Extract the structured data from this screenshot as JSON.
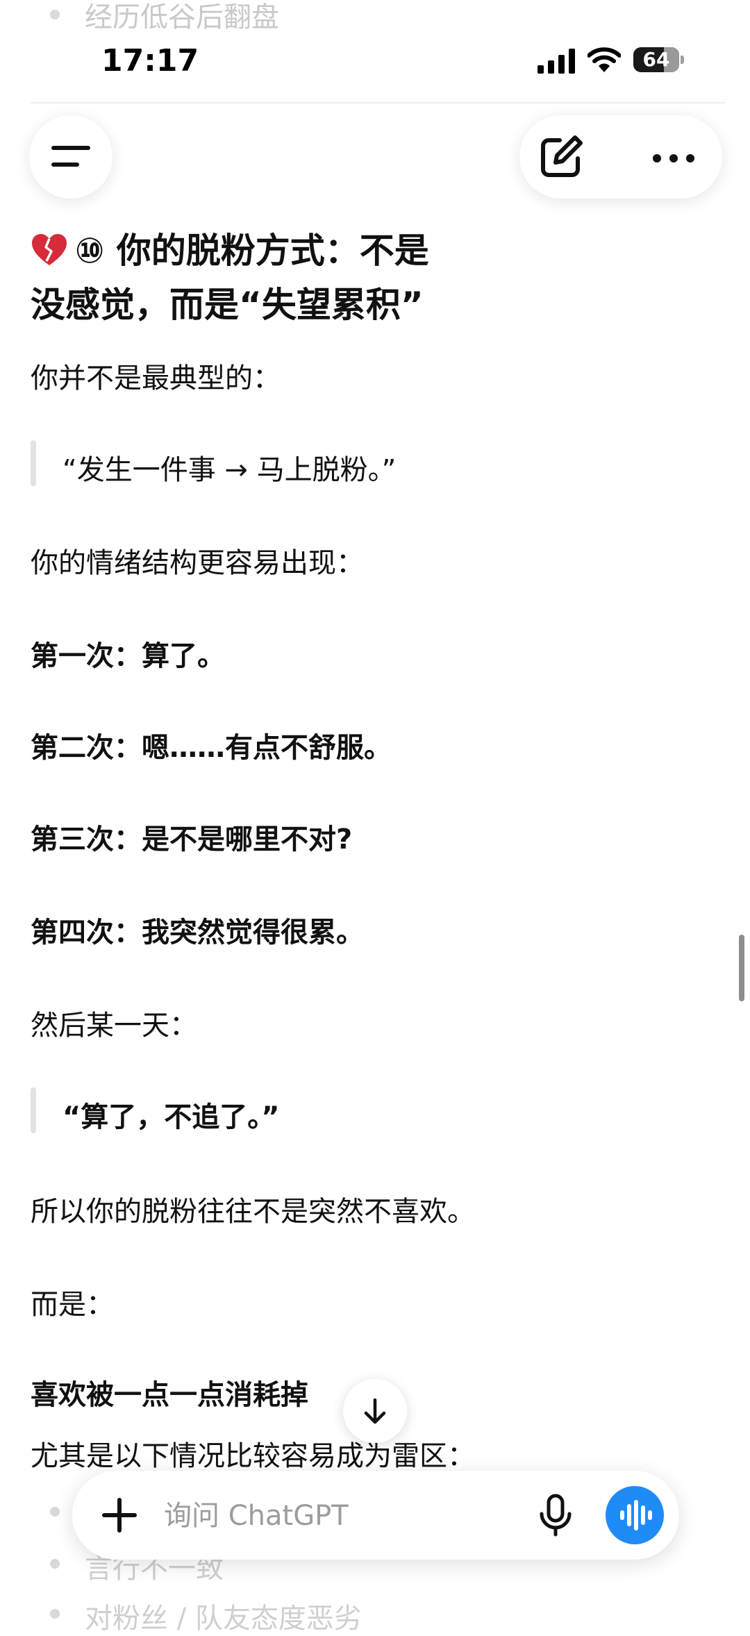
{
  "top_fade": {
    "text": "经历低谷后翻盘"
  },
  "status_bar": {
    "time": "17:17",
    "battery": "64"
  },
  "section": {
    "title_line1": "⑩ 你的脱粉方式：不是",
    "title_line2": "没感觉，而是“失望累积”"
  },
  "content": {
    "intro": "你并不是最典型的：",
    "quote1": "“发生一件事 → 马上脱粉。”",
    "structure": "你的情绪结构更容易出现：",
    "steps": [
      {
        "label": "第一次：",
        "text": "算了。"
      },
      {
        "label": "第二次：",
        "text": "嗯……有点不舒服。"
      },
      {
        "label": "第三次：",
        "text": "是不是哪里不对?"
      },
      {
        "label": "第四次：",
        "text": "我突然觉得很累。"
      }
    ],
    "then": "然后某一天：",
    "quote2": "“算了，不追了。”",
    "so": "所以你的脱粉往往不是突然不喜欢。",
    "but": "而是：",
    "emphasis": "喜欢被一点一点消耗掉",
    "especially": "尤其是以下情况比较容易成为雷区："
  },
  "bottom_list": [
    "言行不一致",
    "对粉丝 / 队友态度恶劣"
  ],
  "composer": {
    "placeholder": "询问 ChatGPT"
  },
  "colors": {
    "accent": "#1f8bf6",
    "quote_bar": "#e2e2e2"
  }
}
